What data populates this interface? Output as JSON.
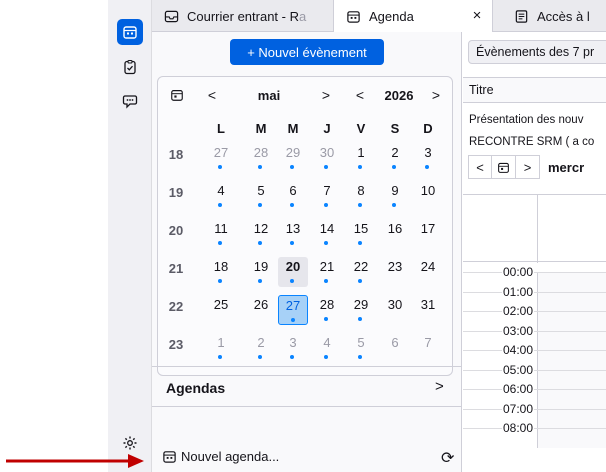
{
  "tabs": [
    {
      "label": "Courrier entrant - R",
      "fade": "a"
    },
    {
      "label": "Agenda"
    },
    {
      "label": "Accès à l"
    }
  ],
  "tab_close": "×",
  "new_event_label": "+ Nouvel évènement",
  "minical": {
    "month": "mai",
    "year": "2026",
    "prev": "<",
    "next": ">",
    "weekdays": [
      "L",
      "M",
      "M",
      "J",
      "V",
      "S",
      "D"
    ],
    "weeks": [
      {
        "num": "18",
        "days": [
          {
            "d": "27",
            "o": true,
            "dot": true
          },
          {
            "d": "28",
            "o": true,
            "dot": true
          },
          {
            "d": "29",
            "o": true,
            "dot": true
          },
          {
            "d": "30",
            "o": true,
            "dot": true
          },
          {
            "d": "1",
            "dot": true
          },
          {
            "d": "2",
            "dot": true
          },
          {
            "d": "3",
            "dot": true
          }
        ]
      },
      {
        "num": "19",
        "days": [
          {
            "d": "4",
            "dot": true
          },
          {
            "d": "5",
            "dot": true
          },
          {
            "d": "6",
            "dot": true
          },
          {
            "d": "7",
            "dot": true
          },
          {
            "d": "8",
            "dot": true
          },
          {
            "d": "9",
            "dot": true
          },
          {
            "d": "10"
          }
        ]
      },
      {
        "num": "20",
        "days": [
          {
            "d": "11",
            "dot": true
          },
          {
            "d": "12",
            "dot": true
          },
          {
            "d": "13",
            "dot": true
          },
          {
            "d": "14",
            "dot": true
          },
          {
            "d": "15",
            "dot": true
          },
          {
            "d": "16"
          },
          {
            "d": "17"
          }
        ]
      },
      {
        "num": "21",
        "days": [
          {
            "d": "18",
            "dot": true
          },
          {
            "d": "19",
            "dot": true
          },
          {
            "d": "20",
            "today": true,
            "dot": true
          },
          {
            "d": "21",
            "dot": true
          },
          {
            "d": "22",
            "dot": true
          },
          {
            "d": "23"
          },
          {
            "d": "24"
          }
        ]
      },
      {
        "num": "22",
        "days": [
          {
            "d": "25"
          },
          {
            "d": "26"
          },
          {
            "d": "27",
            "sel": true,
            "dot": true
          },
          {
            "d": "28",
            "dot": true
          },
          {
            "d": "29",
            "dot": true
          },
          {
            "d": "30"
          },
          {
            "d": "31"
          }
        ]
      },
      {
        "num": "23",
        "days": [
          {
            "d": "1",
            "o": true,
            "dot": true
          },
          {
            "d": "2",
            "o": true,
            "dot": true
          },
          {
            "d": "3",
            "o": true,
            "dot": true
          },
          {
            "d": "4",
            "o": true,
            "dot": true
          },
          {
            "d": "5",
            "o": true,
            "dot": true
          },
          {
            "d": "6",
            "o": true
          },
          {
            "d": "7",
            "o": true
          }
        ]
      }
    ]
  },
  "agendas_label": "Agendas",
  "agendas_chevron": ">",
  "new_calendar_label": "Nouvel agenda...",
  "sync_glyph": "⟳",
  "right": {
    "range_label": "Évènements des 7 pr",
    "column_title": "Titre",
    "events": [
      "Présentation des nouv",
      "RECONTRE SRM ( a co"
    ],
    "nav_prev": "<",
    "nav_next": ">",
    "date_label": "mercr",
    "hours": [
      "00:00",
      "01:00",
      "02:00",
      "03:00",
      "04:00",
      "05:00",
      "06:00",
      "07:00",
      "08:00"
    ]
  },
  "colors": {
    "accent": "#0061e0",
    "dot": "#0a84ff",
    "arrow": "#c00000"
  }
}
